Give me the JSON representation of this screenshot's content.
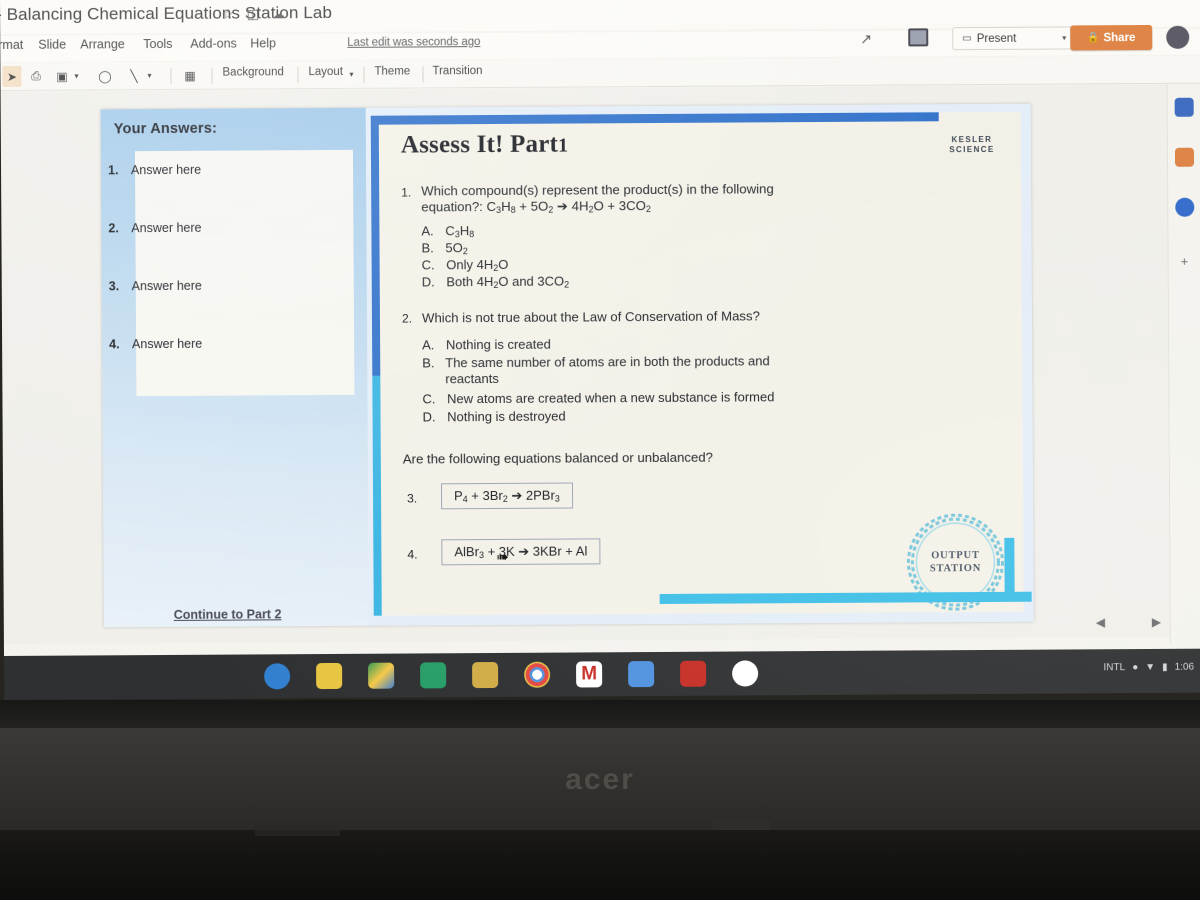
{
  "window": {
    "doc_title": "- Balancing Chemical Equations Station Lab",
    "title_icons": [
      "star-icon",
      "move-to-folder-icon",
      "cloud-status-icon"
    ],
    "menus": [
      "rmat",
      "Slide",
      "Arrange",
      "Tools",
      "Add-ons",
      "Help"
    ],
    "last_edit": "Last edit was seconds ago"
  },
  "toolbar": {
    "items": [
      "select-tool",
      "textbox-tool",
      "image-tool",
      "image-caret",
      "shape-tool",
      "line-tool",
      "line-caret",
      "table-tool"
    ],
    "background_label": "Background",
    "layout_label": "Layout",
    "theme_label": "Theme",
    "transition_label": "Transition"
  },
  "actions": {
    "present_label": "Present",
    "present_caret": "▾",
    "share_label": "Share",
    "share_color": "#e0813f",
    "history_icon": "edit-history-icon",
    "comment_icon": "comment-icon",
    "avatar": "user-avatar"
  },
  "rail": {
    "items": [
      {
        "name": "calendar-icon",
        "color": "#3b6bc4"
      },
      {
        "name": "keep-icon",
        "color": "#e0813f"
      },
      {
        "name": "tasks-icon",
        "color": "#2f6ad0"
      }
    ],
    "add_label": "+"
  },
  "slide": {
    "answers_panel": {
      "heading": "Your Answers:",
      "rows": [
        {
          "num": "1.",
          "text": "Answer here"
        },
        {
          "num": "2.",
          "text": "Answer here"
        },
        {
          "num": "3.",
          "text": "Answer here"
        },
        {
          "num": "4.",
          "text": "Answer here"
        }
      ],
      "continue_link": "Continue to Part 2"
    },
    "title": "Assess It!  Part",
    "title_part_number": "1",
    "brand_line1": "KESLER",
    "brand_line2": "SCIENCE",
    "questions": [
      {
        "num": "1.",
        "line1": "Which compound(s) represent the product(s) in the following",
        "line2_prefix": "equation?: ",
        "equation_html": "C<sub>3</sub>H<sub>8</sub> + 5O<sub>2</sub>  ➔ 4H<sub>2</sub>O + 3CO<sub>2</sub>",
        "options": [
          {
            "letter": "A.",
            "html": "C<sub>3</sub>H<sub>8</sub>"
          },
          {
            "letter": "B.",
            "html": "5O<sub>2</sub>"
          },
          {
            "letter": "C.",
            "html": "Only 4H<sub>2</sub>O"
          },
          {
            "letter": "D.",
            "html": "Both 4H<sub>2</sub>O and 3CO<sub>2</sub>"
          }
        ]
      },
      {
        "num": "2.",
        "line1": "Which is not true about the Law of Conservation of Mass?",
        "options": [
          {
            "letter": "A.",
            "html": "Nothing is created"
          },
          {
            "letter": "B.",
            "html": "The same number of atoms are in both the products and<br>reactants"
          },
          {
            "letter": "C.",
            "html": "New atoms are created when a new substance is formed"
          },
          {
            "letter": "D.",
            "html": "Nothing is destroyed"
          }
        ]
      }
    ],
    "balanced_prompt": "Are the following equations balanced or unbalanced?",
    "equation_items": [
      {
        "num": "3.",
        "html": "P<sub>4</sub> + 3Br<sub>2</sub> ➔ 2PBr<sub>3</sub>"
      },
      {
        "num": "4.",
        "html": "AlBr<sub>3</sub> + 3K ➔ 3KBr + Al"
      }
    ],
    "stamp_line1": "OUTPUT",
    "stamp_line2": "STATION",
    "accent_blue": "#2f73d0",
    "accent_cyan": "#35bde8"
  },
  "shelf": {
    "apps": [
      {
        "name": "meet-icon",
        "color": "#2a7fd4"
      },
      {
        "name": "slides-icon",
        "color": "#e6c235"
      },
      {
        "name": "drive-icon",
        "color": "#3b7fd4"
      },
      {
        "name": "sheets-icon",
        "color": "#1f9d63"
      },
      {
        "name": "classroom-icon",
        "color": "#cfa93b"
      },
      {
        "name": "chrome-icon",
        "color": "#e8e8e8"
      },
      {
        "name": "gmail-icon",
        "color": "#e9e9e9"
      },
      {
        "name": "docs-icon",
        "color": "#4a90e2"
      },
      {
        "name": "youtube-icon",
        "color": "#cc2a21"
      },
      {
        "name": "play-store-icon",
        "color": "#eeeeee"
      }
    ],
    "tray": {
      "locale": "INTL",
      "status_icons": [
        "notification-icon",
        "wifi-icon",
        "battery-icon"
      ],
      "time": "1:06"
    }
  },
  "hardware": {
    "brand": "acer"
  }
}
